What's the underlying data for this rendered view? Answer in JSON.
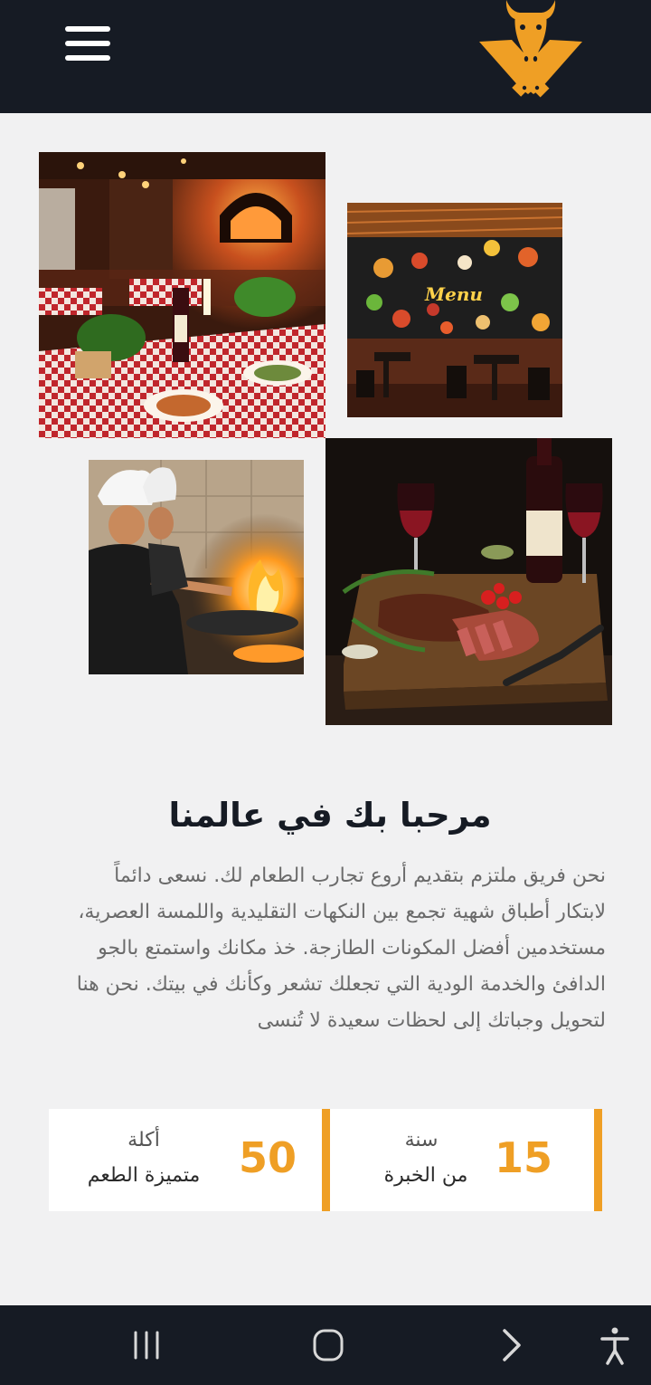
{
  "header": {
    "menu_icon": "hamburger-menu-icon",
    "logo_icon": "bull-head-crossed-cleavers-logo",
    "colors": {
      "background": "#161b24",
      "brand": "#ef9f25"
    }
  },
  "gallery": {
    "images": [
      {
        "name": "restaurant-interior-photo",
        "alt": "Candlelit trattoria with checked tablecloths and brick oven"
      },
      {
        "name": "menu-wall-photo",
        "alt": "Dining room with chalkboard food menu mural"
      },
      {
        "name": "chefs-cooking-photo",
        "alt": "Chefs cooking with flaming wok"
      },
      {
        "name": "steak-wine-photo",
        "alt": "Sliced steak on board with red wine"
      }
    ],
    "menu_wall_text": "Menu"
  },
  "welcome": {
    "title": "مرحبا بك في عالمنا",
    "body": "نحن فريق ملتزم بتقديم أروع تجارب الطعام لك. نسعى دائماً لابتكار أطباق شهية تجمع بين النكهات التقليدية واللمسة العصرية، مستخدمين أفضل المكونات الطازجة. خذ مكانك واستمتع بالجو الدافئ والخدمة الودية التي تجعلك تشعر وكأنك في بيتك. نحن هنا لتحويل وجباتك إلى لحظات سعيدة لا تُنسى"
  },
  "stats": [
    {
      "number": "15",
      "label_top": "سنة",
      "label_bottom": "من الخبرة"
    },
    {
      "number": "50",
      "label_top": "أكلة",
      "label_bottom": "متميزة الطعم"
    }
  ],
  "system_nav": {
    "recents_icon": "recent-apps-icon",
    "home_icon": "home-icon",
    "back_icon": "back-chevron-icon",
    "accessibility_icon": "accessibility-icon"
  }
}
